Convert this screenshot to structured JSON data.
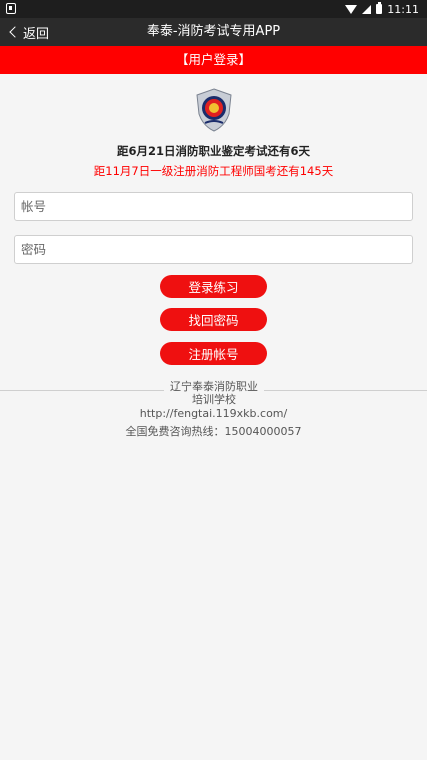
{
  "status_bar": {
    "time": "11:11"
  },
  "app_bar": {
    "back_label": "返回",
    "title": "奉泰-消防考试专用APP"
  },
  "header": {
    "title": "【用户登录】"
  },
  "countdown": {
    "line1": "距6月21日消防职业鉴定考试还有6天",
    "line2": "距11月7日一级注册消防工程师国考还有145天"
  },
  "form": {
    "account_placeholder": "帐号",
    "password_placeholder": "密码"
  },
  "buttons": {
    "login": "登录练习",
    "find_password": "找回密码",
    "register": "注册帐号"
  },
  "footer": {
    "school_line1": "辽宁奉泰消防职业",
    "school_line2": "培训学校",
    "url": "http://fengtai.119xkb.com/",
    "hotline": "全国免费咨询热线：15004000057"
  },
  "colors": {
    "accent_red": "#ff0000",
    "button_red": "#ef1010",
    "app_bar": "#2b2b2b",
    "status_bar": "#1e1e1e"
  }
}
